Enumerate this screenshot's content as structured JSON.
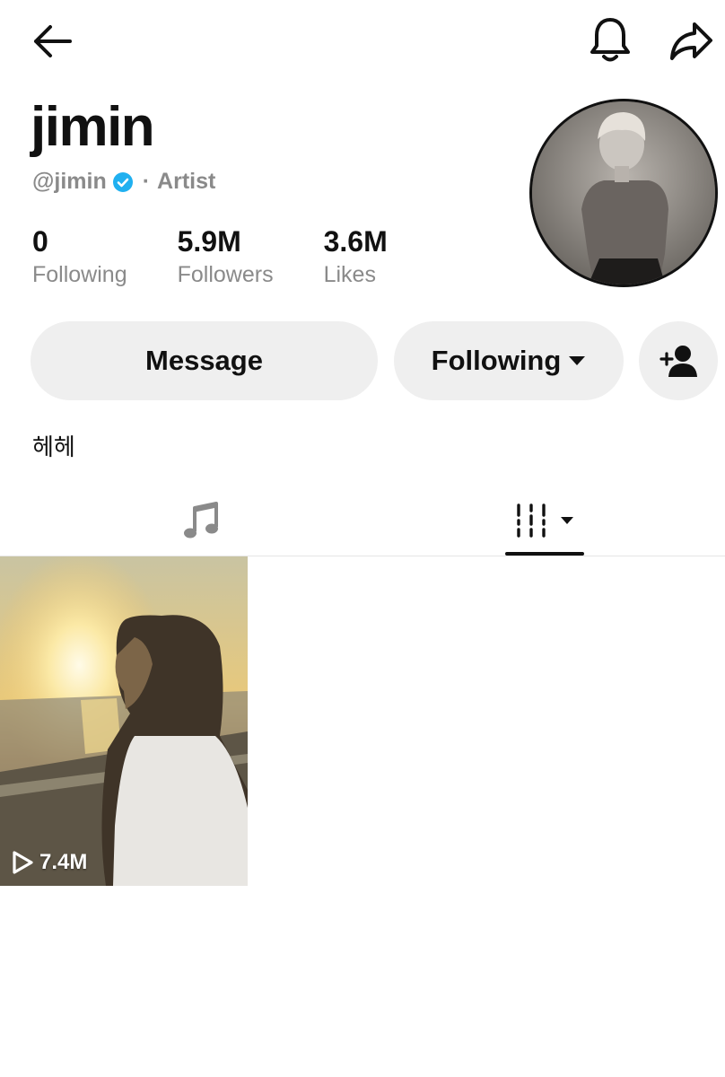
{
  "profile": {
    "display_name": "jimin",
    "handle": "@jimin",
    "separator": "·",
    "category": "Artist",
    "bio": "헤헤",
    "verified": true
  },
  "stats": [
    {
      "value": "0",
      "label": "Following"
    },
    {
      "value": "5.9M",
      "label": "Followers"
    },
    {
      "value": "3.6M",
      "label": "Likes"
    }
  ],
  "actions": {
    "message_label": "Message",
    "following_label": "Following"
  },
  "tabs": [
    {
      "icon": "music-note-icon",
      "active": false
    },
    {
      "icon": "videos-grid-icon",
      "active": true
    }
  ],
  "videos": [
    {
      "views": "7.4M"
    }
  ],
  "colors": {
    "verified_badge": "#20b0f0",
    "button_bg": "#efefef",
    "muted_text": "#8a8a8a"
  }
}
